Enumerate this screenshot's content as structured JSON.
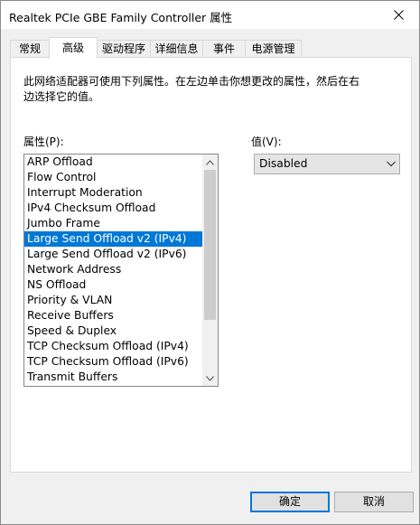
{
  "window": {
    "title": "Realtek PCIe GBE Family Controller 属性"
  },
  "tabs": [
    {
      "label": "常规"
    },
    {
      "label": "高级"
    },
    {
      "label": "驱动程序"
    },
    {
      "label": "详细信息"
    },
    {
      "label": "事件"
    },
    {
      "label": "电源管理"
    }
  ],
  "active_tab_index": 1,
  "advanced": {
    "description": "此网络适配器可使用下列属性。在左边单击你想更改的属性，然后在右边选择它的值。",
    "property_label": "属性(P):",
    "value_label": "值(V):",
    "properties": [
      "ARP Offload",
      "Flow Control",
      "Interrupt Moderation",
      "IPv4 Checksum Offload",
      "Jumbo Frame",
      "Large Send Offload v2 (IPv4)",
      "Large Send Offload v2 (IPv6)",
      "Network Address",
      "NS Offload",
      "Priority & VLAN",
      "Receive Buffers",
      "Speed & Duplex",
      "TCP Checksum Offload (IPv4)",
      "TCP Checksum Offload (IPv6)",
      "Transmit Buffers"
    ],
    "selected_property_index": 5,
    "value": "Disabled"
  },
  "buttons": {
    "ok": "确定",
    "cancel": "取消"
  },
  "icons": {
    "close": "close-icon",
    "scroll_up": "chevron-up-icon",
    "scroll_down": "chevron-down-icon",
    "combo_arrow": "chevron-down-icon"
  },
  "colors": {
    "selection": "#0078d7",
    "default_button_border": "#0078d7"
  }
}
